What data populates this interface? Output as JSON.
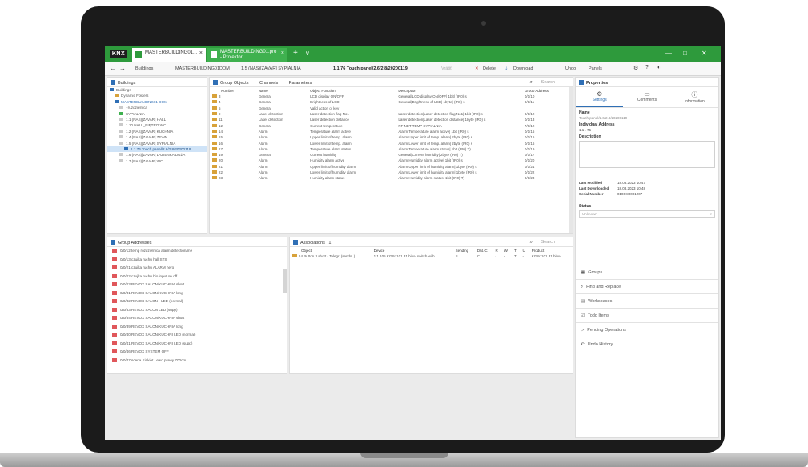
{
  "window": {
    "logo": "KNX",
    "tabs": [
      {
        "label": "MASTERBUILDING01..."
      },
      {
        "label": "MASTERBUILDING01.pro - Projektor"
      }
    ],
    "add_tab": "+",
    "menu": "∨",
    "minimize": "—",
    "maximize": "□",
    "close": "✕"
  },
  "toolbar": {
    "back": "←",
    "forward": "→",
    "buildings_label": "Buildings",
    "crumb1": "MASTERBUILDING01DOM",
    "crumb2": "1.5 (NAS)[ZAVAR] SYPIALNIA",
    "crumb3": "1.1.76 Touch panel/2.6/2.8/20200119",
    "undo_hint": "Vrátiť",
    "delete_label": "Delete",
    "download_label": "Download",
    "undo_label": "Undo",
    "panels_label": "Panels"
  },
  "buildings_panel": {
    "title": "Buildings",
    "rows": [
      "Buildings",
      "Dynamic Folders",
      "MASTERBUILDING01 DOM",
      "+ruzdzielnica",
      "SYPIALNIA",
      "1.1 (NAS)[ZAVAR] HALL",
      "1.10 HALL_PIĘTRO WC",
      "1.2 (NAS)[ZAVAR] KUCHNIA",
      "1.4 (NAS)[ZAVAR] ZEWN",
      "1.5 (NAS)[ZAVAR] SYPIALNIA",
      "1.1.76 Touch panel/2.6/2.8/20200119",
      "1.6 (NAS)[ZAVAR] LAZIENKA DUŻA",
      "1.7 (NAS)[ZAVAR] WC"
    ]
  },
  "group_objects_panel": {
    "tabs": [
      "Group Objects",
      "Channels",
      "Parameters"
    ],
    "search_placeholder": "Search",
    "columns": [
      "Number",
      "Name",
      "Object Function",
      "Description",
      "Group Address"
    ],
    "rows": [
      [
        "3",
        "General",
        "LCD display ON/OFF",
        "General|LCD display ON/OFF| 1bit| (IR0) s",
        "0/1/10"
      ],
      [
        "4",
        "General",
        "Brightness of LCD",
        "General|Brightness of LCD| 1byte| (IR0) s",
        "0/1/11"
      ],
      [
        "5",
        "General",
        "Valid action of key",
        "",
        ""
      ],
      [
        "9",
        "Laser detection",
        "Laser detection flag No1",
        "Laser detection|Laser detection flag No1| 1bit (IR0) s",
        "0/1/12"
      ],
      [
        "11",
        "Laser detection",
        "Laser detection distance",
        "Laser detection|Laser detection distance| 1byte (IR0) s",
        "0/1/13"
      ],
      [
        "12",
        "General",
        "Current temperature",
        "RF NET TEMP SYPIALNIA",
        "7/0/12"
      ],
      [
        "14",
        "Alarm",
        "Temperature alarm active",
        "Alarm|Temperature alarm active| 1bit (IR0) s",
        "0/1/15"
      ],
      [
        "15",
        "Alarm",
        "Upper limit of temp. alarm",
        "Alarm|Upper limit of temp. alarm| 2byte (IR0) s",
        "0/1/16"
      ],
      [
        "16",
        "Alarm",
        "Lower limit of temp. alarm",
        "Alarm|Lower limit of temp. alarm| 2byte (IR0) s",
        "0/1/16"
      ],
      [
        "17",
        "Alarm",
        "Temperature alarm status",
        "Alarm|Temperature alarm status| 1bit (IR0) T)",
        "0/1/19"
      ],
      [
        "19",
        "General",
        "Current humidity",
        "General|Current humidity| 2byte (IR0) T)",
        "0/1/17"
      ],
      [
        "20",
        "Alarm",
        "Humidity alarm active",
        "Alarm|Humidity alarm active| 1bit (IR0) s",
        "0/1/20"
      ],
      [
        "21",
        "Alarm",
        "Upper limit of humidity alarm",
        "Alarm|Upper limit of humidity alarm| 1byte (IR0) s",
        "0/1/21"
      ],
      [
        "22",
        "Alarm",
        "Lower limit of humidity alarm",
        "Alarm|Lower limit of humidity alarm| 1byte (IR0) s",
        "0/1/22"
      ],
      [
        "23",
        "Alarm",
        "Humidity alarm status",
        "Alarm|Humidity alarm status| 1bit (IR0) T)",
        "0/1/23"
      ]
    ]
  },
  "properties_panel": {
    "title": "Properties",
    "tabs": [
      {
        "label": "Settings",
        "icon": "⚙"
      },
      {
        "label": "Comments",
        "icon": "▭"
      },
      {
        "label": "Information",
        "icon": "ⓘ"
      }
    ],
    "name_label": "Name",
    "name_value": "Touch panel/2.6/2.8/20200119",
    "ind_addr_label": "Individual Address",
    "ind_addr_value": "1.1 . 76",
    "description_label": "Description",
    "last_modified_label": "Last Modified",
    "last_modified_value": "18.08.2023 10:47",
    "last_downloaded_label": "Last Downloaded",
    "last_downloaded_value": "18.08.2023 10:48",
    "serial_label": "Serial Number",
    "serial_value": "0106:80001207",
    "status_label": "Status",
    "status_value": "Unknown",
    "nav": [
      {
        "icon": "▦",
        "label": "Groups"
      },
      {
        "icon": "⌕",
        "label": "Find and Replace"
      },
      {
        "icon": "▤",
        "label": "Workspaces"
      },
      {
        "icon": "☑",
        "label": "Todo Items"
      },
      {
        "icon": "▷",
        "label": "Pending Operations"
      },
      {
        "icon": "↶",
        "label": "Undo History"
      }
    ]
  },
  "group_addresses_panel": {
    "title": "Group Addresses",
    "rows": [
      "0/0/12 temp rozdzielnica alarm detection/me",
      "0/0/13 czujka ruchu hall STS",
      "0/0/21 czujka ruchu ALARM hero",
      "0/0/22 czujka ruchu bio input on off",
      "0/0/23 REVOX SALON/KUCHNIA short",
      "0/0/31 REVOX SALON/KUCHNIA long",
      "0/0/32 REVOX SALON - LED (normal)",
      "0/0/33 REVOX SALON LED (supp)",
      "0/0/34 REVOX SALON/KUCHNIA short",
      "0/0/39 REVOX SALON/KUCHNIA long",
      "0/0/40 REVOX SALON/KUCHNI LED (normal)",
      "0/0/41 REVOX SALON/KUCHNI LED (supp)",
      "0/0/46 REVOX SYSTEM OFF",
      "0/0/47 scena Kinkiet Lewo prawy 700cm"
    ]
  },
  "associations_panel": {
    "title": "Associations",
    "count": "1",
    "search_placeholder": "Search",
    "columns": [
      "Object",
      "Device",
      "Sending",
      "Dat. C",
      "R",
      "W",
      "T",
      "U",
      "Product"
    ],
    "rows": [
      [
        "14 Button 3 short - Telegr. (sends..)",
        "1.1.105 KGSr 101 31 bituv switch with..",
        "S",
        "C",
        "-",
        "-",
        "T",
        "-",
        "KGSr 101 31 bituv.."
      ]
    ]
  }
}
